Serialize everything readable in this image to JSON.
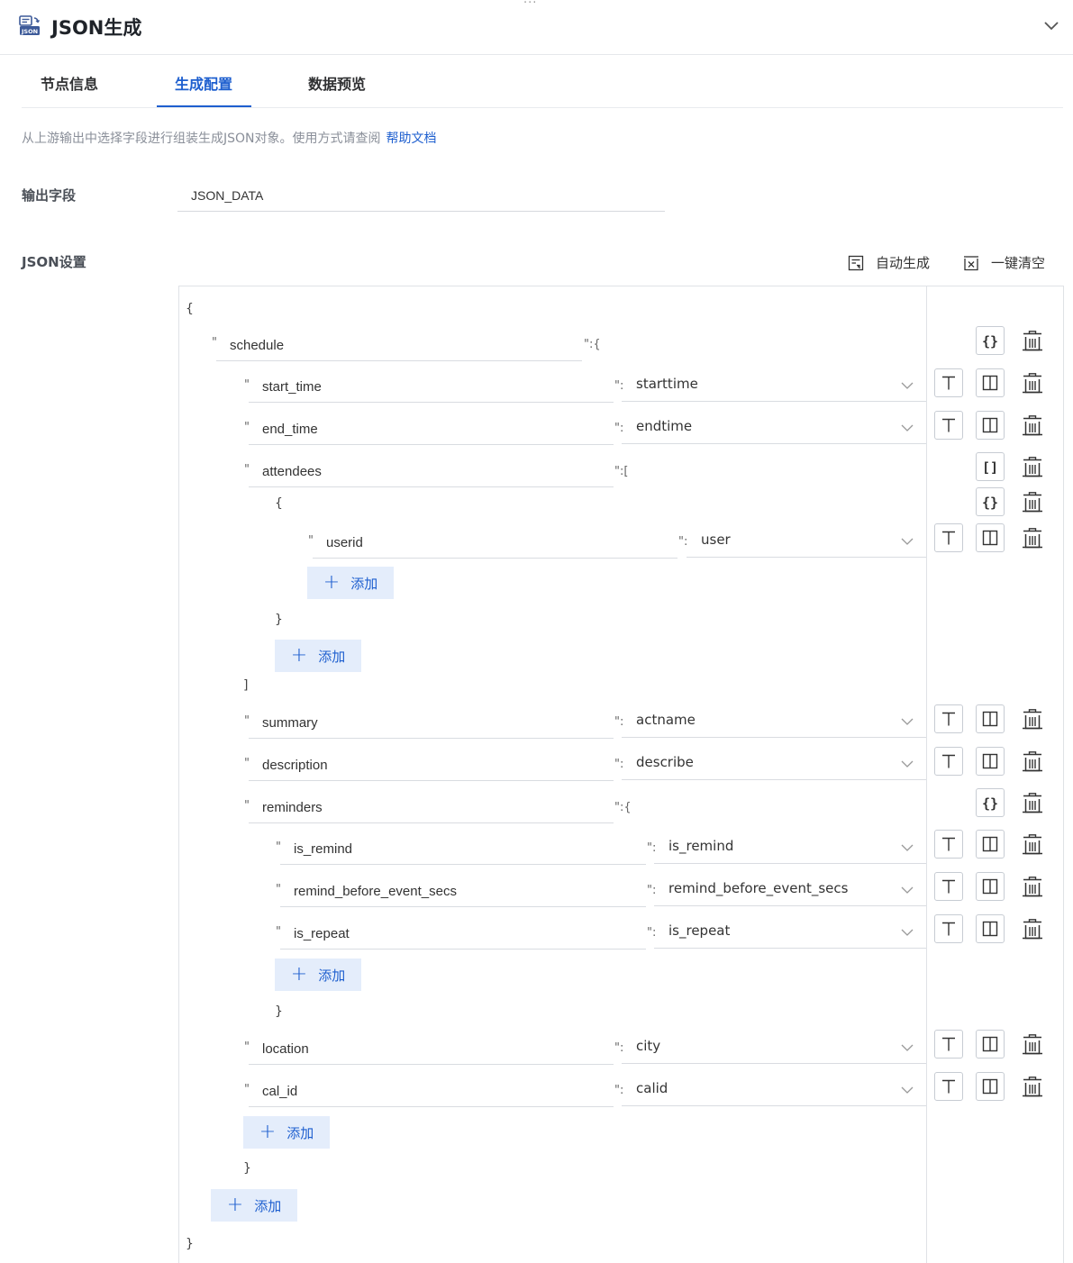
{
  "header": {
    "title": "JSON生成",
    "drag_handle": "···",
    "icon": "json-icon"
  },
  "tabs": [
    {
      "label": "节点信息"
    },
    {
      "label": "生成配置",
      "active": true
    },
    {
      "label": "数据预览"
    }
  ],
  "description": {
    "text": "从上游输出中选择字段进行组装生成JSON对象。使用方式请查阅",
    "link": "帮助文档"
  },
  "output_field": {
    "label": "输出字段",
    "value": "JSON_DATA"
  },
  "json_settings": {
    "label": "JSON设置",
    "auto_generate": "自动生成",
    "clear_all": "一键清空"
  },
  "editor": {
    "add_label": "添加",
    "root_open": "{",
    "root_close": "}",
    "schedule_key": "schedule",
    "start_time": {
      "key": "start_time",
      "value": "starttime"
    },
    "end_time": {
      "key": "end_time",
      "value": "endtime"
    },
    "attendees_key": "attendees",
    "userid": {
      "key": "userid",
      "value": "user"
    },
    "summary": {
      "key": "summary",
      "value": "actname"
    },
    "description": {
      "key": "description",
      "value": "describe"
    },
    "reminders_key": "reminders",
    "is_remind": {
      "key": "is_remind",
      "value": "is_remind"
    },
    "remind_before": {
      "key": "remind_before_event_secs",
      "value": "remind_before_event_secs"
    },
    "is_repeat": {
      "key": "is_repeat",
      "value": "is_repeat"
    },
    "location": {
      "key": "location",
      "value": "city"
    },
    "cal_id": {
      "key": "cal_id",
      "value": "calid"
    }
  },
  "colors": {
    "accent": "#1e5fcf",
    "add_bg": "#e4edfb",
    "border": "#dfe2e6"
  }
}
